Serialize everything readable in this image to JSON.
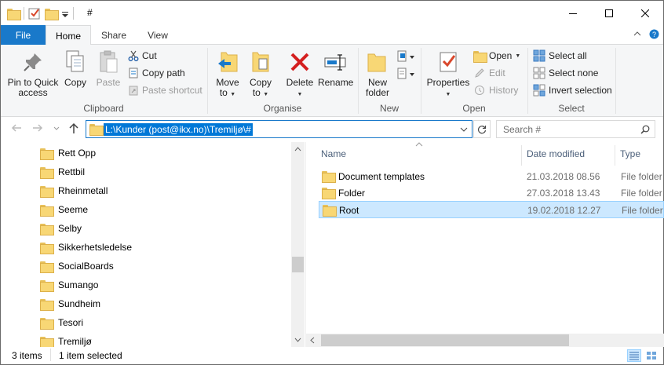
{
  "titlebar": {
    "title": "#",
    "quick_access": [
      "folder-icon",
      "properties-check-icon",
      "new-folder-icon",
      "customize-dropdown"
    ],
    "controls": [
      "minimize",
      "maximize",
      "close"
    ]
  },
  "tabs": [
    {
      "label": "File",
      "style": "accent"
    },
    {
      "label": "Home",
      "active": true
    },
    {
      "label": "Share"
    },
    {
      "label": "View"
    }
  ],
  "ribbon": {
    "clipboard": {
      "group_label": "Clipboard",
      "pin_label_1": "Pin to Quick",
      "pin_label_2": "access",
      "copy_label": "Copy",
      "paste_label": "Paste",
      "cut_label": "Cut",
      "copy_path_label": "Copy path",
      "paste_shortcut_label": "Paste shortcut"
    },
    "organise": {
      "group_label": "Organise",
      "move_to_label_1": "Move",
      "move_to_label_2": "to",
      "copy_to_label_1": "Copy",
      "copy_to_label_2": "to",
      "delete_label": "Delete",
      "rename_label": "Rename"
    },
    "new": {
      "group_label": "New",
      "new_folder_label_1": "New",
      "new_folder_label_2": "folder"
    },
    "open": {
      "group_label": "Open",
      "properties_label": "Properties",
      "open_label": "Open",
      "edit_label": "Edit",
      "history_label": "History"
    },
    "select": {
      "group_label": "Select",
      "select_all_label": "Select all",
      "select_none_label": "Select none",
      "invert_label": "Invert selection"
    }
  },
  "address": {
    "path": "L:\\Kunder (post@ikx.no)\\Tremiljø\\#",
    "search_placeholder": "Search #"
  },
  "nav_tree": [
    "Rett Opp",
    "Rettbil",
    "Rheinmetall",
    "Seeme",
    "Selby",
    "Sikkerhetsledelse",
    "SocialBoards",
    "Sumango",
    "Sundheim",
    "Tesori",
    "Tremiljø"
  ],
  "columns": {
    "name": "Name",
    "date": "Date modified",
    "type": "Type"
  },
  "files": [
    {
      "name": "Document templates",
      "date": "21.03.2018 08.56",
      "type": "File folder",
      "selected": false
    },
    {
      "name": "Folder",
      "date": "27.03.2018 13.43",
      "type": "File folder",
      "selected": false
    },
    {
      "name": "Root",
      "date": "19.02.2018 12.27",
      "type": "File folder",
      "selected": true
    }
  ],
  "status": {
    "item_count": "3 items",
    "selection": "1 item selected"
  },
  "colors": {
    "accent": "#1979ca",
    "selection": "#cce8ff",
    "address_selection": "#0078d7"
  }
}
